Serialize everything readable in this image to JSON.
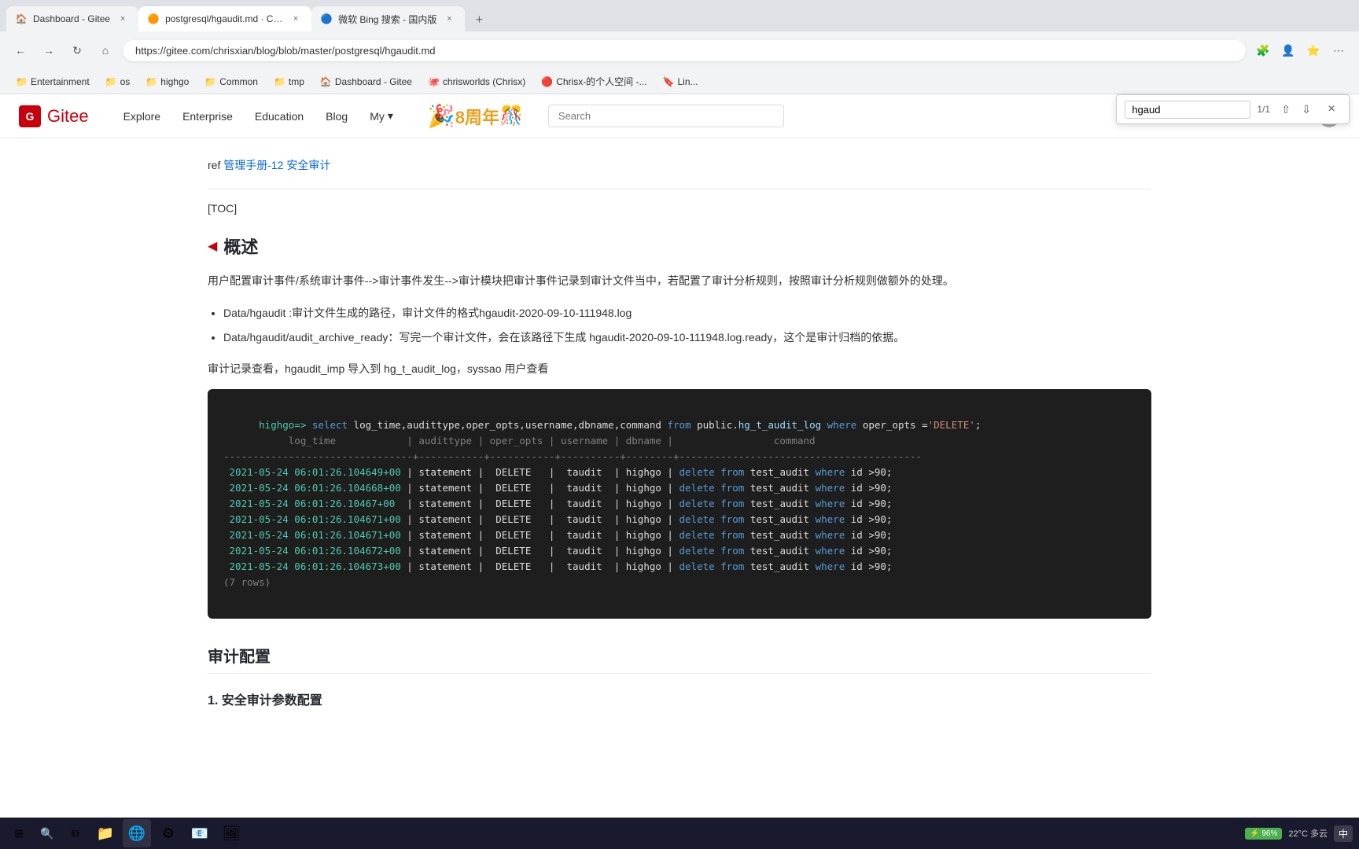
{
  "browser": {
    "tabs": [
      {
        "id": "tab1",
        "title": "Dashboard - Gitee",
        "favicon": "🏠",
        "active": false,
        "url": ""
      },
      {
        "id": "tab2",
        "title": "postgresql/hgaudit.md · Chrisx/...",
        "favicon": "🟠",
        "active": true,
        "url": "https://gitee.com/chrisxian/blog/blob/master/postgresql/hgaudit.md"
      },
      {
        "id": "tab3",
        "title": "微软 Bing 搜索 - 国内版",
        "favicon": "🔵",
        "active": false,
        "url": ""
      }
    ],
    "address": "https://gitee.com/chrisxian/blog/blob/master/postgresql/hgaudit.md"
  },
  "bookmarks": [
    {
      "label": "Entertainment",
      "icon": "📁"
    },
    {
      "label": "os",
      "icon": "📁"
    },
    {
      "label": "highgo",
      "icon": "📁"
    },
    {
      "label": "Common",
      "icon": "📁"
    },
    {
      "label": "tmp",
      "icon": "📁"
    },
    {
      "label": "Dashboard - Gitee",
      "icon": "🏠"
    },
    {
      "label": "chrisworlds (Chrisx)",
      "icon": "🐙"
    },
    {
      "label": "Chrisx-的个人空间 -...",
      "icon": "🔴"
    },
    {
      "label": "Lin...",
      "icon": "🔖"
    }
  ],
  "findbar": {
    "query": "hgaud",
    "count": "1/1"
  },
  "gitee": {
    "logo_text": "Gitee",
    "nav": [
      "Explore",
      "Enterprise",
      "Education",
      "Blog"
    ],
    "nav_dropdown": "My",
    "search_placeholder": "Search"
  },
  "page": {
    "ref_text": "ref 管理手册-12 安全审计",
    "toc": "[TOC]",
    "section1_title": "概述",
    "description": "用户配置审计事件/系统审计事件-->审计事件发生-->审计模块把审计事件记录到审计文件当中，若配置了审计分析规则，按照审计分析规则做额外的处理。",
    "bullets": [
      "Data/hgaudit :审计文件生成的路径，审计文件的格式hgaudit-2020-09-10-111948.log",
      "Data/hgaudit/audit_archive_ready：写完一个审计文件，会在该路径下生成 hgaudit-2020-09-10-111948.log.ready，这个是审计归档的依据。"
    ],
    "inline_text": "审计记录查看，hgaudit_imp 导入到 hg_t_audit_log，syssao 用户查看",
    "section2_title": "审计配置",
    "section3_title": "1. 安全审计参数配置",
    "code": {
      "prompt": "highgo=> ",
      "query": "select log_time,audittype,oper_opts,username,dbname,command from public.hg_t_audit_log where oper_opts ='DELETE';",
      "header": "           log_time            | audittype | oper_opts | username | dbname |                 command",
      "separator": "--------------------------------+-----------+-----------+----------+--------+-----------------------------------------",
      "rows": [
        " 2021-05-24 06:01:26.104649+00 | statement |  DELETE   |  taudit  | highgo | delete from test_audit where id >90;",
        " 2021-05-24 06:01:26.104668+00 | statement |  DELETE   |  taudit  | highgo | delete from test_audit where id >90;",
        " 2021-05-24 06:01:26.10467+00  | statement |  DELETE   |  taudit  | highgo | delete from test_audit where id >90;",
        " 2021-05-24 06:01:26.104671+00 | statement |  DELETE   |  taudit  | highgo | delete from test_audit where id >90;",
        " 2021-05-24 06:01:26.104671+00 | statement |  DELETE   |  taudit  | highgo | delete from test_audit where id >90;",
        " 2021-05-24 06:01:26.104672+00 | statement |  DELETE   |  taudit  | highgo | delete from test_audit where id >90;",
        " 2021-05-24 06:01:26.104673+00 | statement |  DELETE   |  taudit  | highgo | delete from test_audit where id >90;"
      ],
      "row_count": "(7 rows)"
    }
  },
  "taskbar": {
    "battery": "96%",
    "weather": "22°C 多云",
    "time": "中"
  }
}
